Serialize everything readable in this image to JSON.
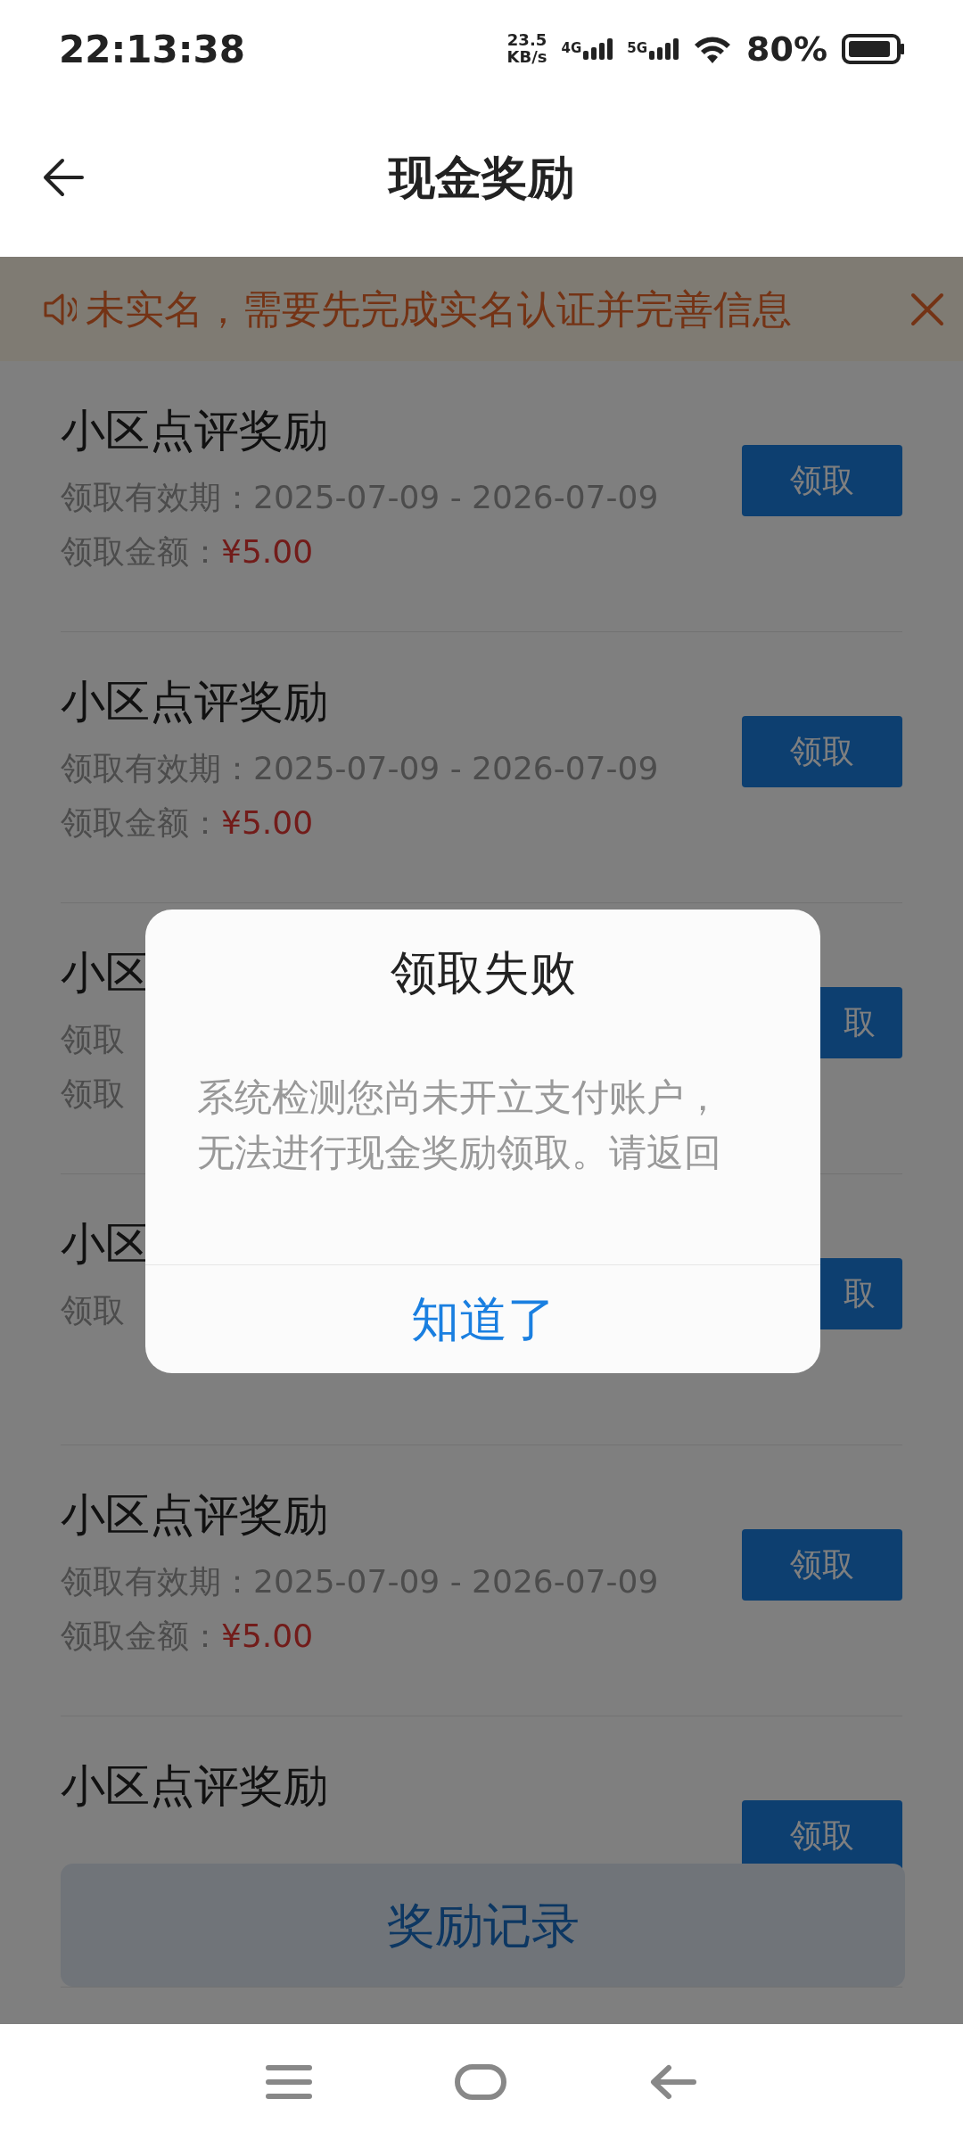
{
  "status_bar": {
    "time": "22:13:38",
    "speed": "23.5",
    "speed_unit": "KB/s",
    "networks": [
      "4G",
      "5G"
    ],
    "battery": "80%"
  },
  "header": {
    "title": "现金奖励"
  },
  "notice": {
    "text": "未实名，需要先完成实名认证并完善信息"
  },
  "rewards": [
    {
      "kind": "full",
      "title": "小区点评奖励",
      "validity_label": "领取有效期：",
      "validity": "2025-07-09 - 2026-07-09",
      "amount_label": "领取金额：",
      "amount": "¥5.00",
      "button": "领取"
    },
    {
      "kind": "full",
      "title": "小区点评奖励",
      "validity_label": "领取有效期：",
      "validity": "2025-07-09 - 2026-07-09",
      "amount_label": "领取金额：",
      "amount": "¥5.00",
      "button": "领取"
    },
    {
      "kind": "partial",
      "title": "小区",
      "validity_label": "领取",
      "amount_label": "领取",
      "button": "取"
    },
    {
      "kind": "partial",
      "title": "小区",
      "validity_label": "领取",
      "button": "取"
    },
    {
      "kind": "full",
      "title": "小区点评奖励",
      "validity_label": "领取有效期：",
      "validity": "2025-07-09 - 2026-07-09",
      "amount_label": "领取金额：",
      "amount": "¥5.00",
      "button": "领取"
    },
    {
      "kind": "full",
      "title": "小区点评奖励",
      "button": "领取"
    }
  ],
  "records_button": "奖励记录",
  "dialog": {
    "title": "领取失败",
    "message": "系统检测您尚未开立支付账户，无法进行现金奖励领取。请返回",
    "button": "知道了"
  }
}
